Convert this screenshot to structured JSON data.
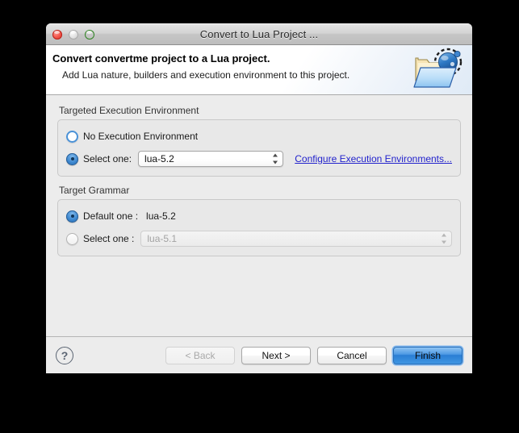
{
  "window": {
    "title": "Convert to Lua Project ...",
    "controls": {
      "close": "close-button",
      "minimize": "minimize-button",
      "zoom": "zoom-button"
    }
  },
  "banner": {
    "title": "Convert convertme project to a Lua project.",
    "subtitle": "Add Lua nature, builders and execution environment to this project.",
    "icon": "lua-project-folder-icon"
  },
  "groups": [
    {
      "label": "Targeted Execution Environment",
      "rows": [
        {
          "radio_label": "No Execution Environment",
          "selected": false
        },
        {
          "radio_label": "Select one:",
          "selected": true,
          "combo_value": "lua-5.2",
          "combo_enabled": true,
          "link": "Configure Execution Environments..."
        }
      ]
    },
    {
      "label": "Target Grammar",
      "rows": [
        {
          "radio_label": "Default one :",
          "selected": true,
          "value_text": "lua-5.2"
        },
        {
          "radio_label": "Select one :",
          "selected": false,
          "combo_value": "lua-5.1",
          "combo_enabled": false
        }
      ]
    }
  ],
  "footer": {
    "help": "?",
    "back": "< Back",
    "next": "Next >",
    "cancel": "Cancel",
    "finish": "Finish"
  },
  "colors": {
    "link": "#2222cc",
    "accent": "#3d87cf",
    "primary_button": "#2a7ed4",
    "dialog_bg": "#ececec",
    "banner_bg": "#ffffff",
    "desktop_bg": "#000000"
  }
}
